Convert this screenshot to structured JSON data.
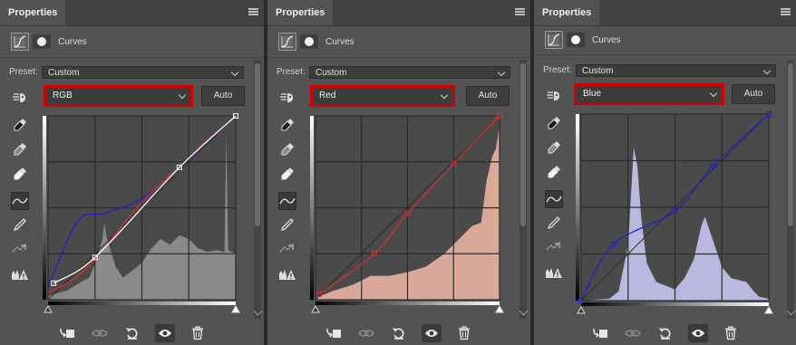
{
  "panels": [
    {
      "tab": "Properties",
      "title": "Curves",
      "preset_label": "Preset:",
      "preset_value": "Custom",
      "channel": "RGB",
      "auto_label": "Auto",
      "channel_color": "#ffffff",
      "histogram_color": "#8a8a8a",
      "curves": [
        {
          "color": "#2222c8",
          "points": [
            [
              0,
              0.07
            ],
            [
              0.16,
              0.43
            ],
            [
              0.3,
              0.47
            ],
            [
              0.5,
              0.55
            ],
            [
              0.7,
              0.72
            ],
            [
              1,
              1
            ]
          ]
        },
        {
          "color": "#d03030",
          "points": [
            [
              0,
              0.04
            ],
            [
              0.12,
              0.1
            ],
            [
              0.25,
              0.22
            ],
            [
              0.5,
              0.53
            ],
            [
              0.72,
              0.74
            ],
            [
              1,
              1
            ]
          ]
        },
        {
          "color": "#ffffff",
          "points": [
            [
              0.03,
              0.09
            ],
            [
              0.25,
              0.23
            ],
            [
              0.7,
              0.72
            ],
            [
              1,
              1
            ]
          ],
          "anchors": [
            [
              0.03,
              0.09
            ],
            [
              0.25,
              0.23
            ],
            [
              0.7,
              0.72
            ],
            [
              1,
              1
            ]
          ]
        }
      ]
    },
    {
      "tab": "Properties",
      "title": "Curves",
      "preset_label": "Preset:",
      "preset_value": "Custom",
      "channel": "Red",
      "auto_label": "Auto",
      "channel_color": "#e03030",
      "histogram_color": "#d9a898",
      "curves": [
        {
          "color": "#d03030",
          "points": [
            [
              0.02,
              0.03
            ],
            [
              0.32,
              0.25
            ],
            [
              0.5,
              0.47
            ],
            [
              0.75,
              0.74
            ],
            [
              1,
              1
            ]
          ],
          "anchors": [
            [
              0.02,
              0.03
            ],
            [
              0.32,
              0.25
            ],
            [
              0.5,
              0.47
            ],
            [
              0.75,
              0.74
            ],
            [
              1,
              1
            ]
          ]
        }
      ]
    },
    {
      "tab": "Properties",
      "title": "Curves",
      "preset_label": "Preset:",
      "preset_value": "Custom",
      "channel": "Blue",
      "auto_label": "Auto",
      "channel_color": "#2a2ad0",
      "histogram_color": "#b8b8e0",
      "curves": [
        {
          "color": "#2222c8",
          "points": [
            [
              0,
              0
            ],
            [
              0.17,
              0.3
            ],
            [
              0.5,
              0.48
            ],
            [
              0.7,
              0.72
            ],
            [
              1,
              1
            ]
          ],
          "anchors": [
            [
              0,
              0
            ],
            [
              0.17,
              0.3
            ],
            [
              0.5,
              0.48
            ],
            [
              0.7,
              0.72
            ],
            [
              1,
              1
            ]
          ]
        }
      ]
    }
  ],
  "icons": {
    "menu": "panel-menu-icon",
    "tools": [
      "on-image-adjust-icon",
      "black-point-eyedropper-icon",
      "gray-point-eyedropper-icon",
      "white-point-eyedropper-icon",
      "curve-point-icon",
      "pencil-icon",
      "smooth-icon",
      "clipping-warning-icon"
    ],
    "footer": [
      "clip-to-layer-icon",
      "view-previous-icon",
      "reset-icon",
      "visibility-eye-icon",
      "delete-icon"
    ]
  }
}
